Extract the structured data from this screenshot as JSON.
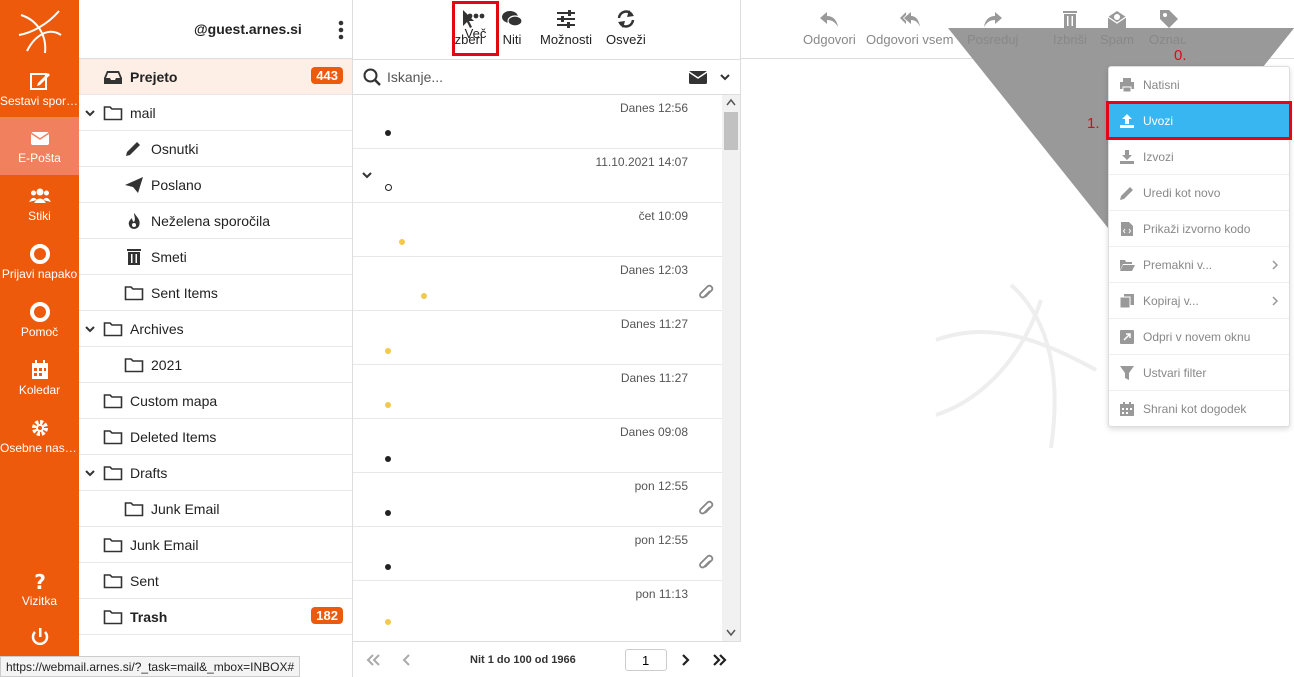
{
  "nav": {
    "items": [
      {
        "label": "Sestavi sporočilo",
        "icon": "compose-icon"
      },
      {
        "label": "E-Pošta",
        "icon": "mail-icon"
      },
      {
        "label": "Stiki",
        "icon": "contacts-icon"
      },
      {
        "label": "Prijavi napako",
        "icon": "lifebuoy-icon"
      },
      {
        "label": "Pomoč",
        "icon": "lifebuoy-icon"
      },
      {
        "label": "Koledar",
        "icon": "calendar-icon"
      },
      {
        "label": "Osebne nastavitve",
        "icon": "gear-icon"
      },
      {
        "label": "Vizitka",
        "icon": "question-icon"
      },
      {
        "label": "Odjava",
        "icon": "power-icon"
      }
    ]
  },
  "folders": {
    "account": "@guest.arnes.si",
    "items": [
      {
        "name": "Prejeto",
        "badge": "443"
      },
      {
        "name": "mail"
      },
      {
        "name": "Osnutki"
      },
      {
        "name": "Poslano"
      },
      {
        "name": "Neželena sporočila"
      },
      {
        "name": "Smeti"
      },
      {
        "name": "Sent Items"
      },
      {
        "name": "Archives"
      },
      {
        "name": "2021"
      },
      {
        "name": "Custom mapa"
      },
      {
        "name": "Deleted Items"
      },
      {
        "name": "Drafts"
      },
      {
        "name": "Junk Email"
      },
      {
        "name": "Junk Email"
      },
      {
        "name": "Sent"
      },
      {
        "name": "Trash",
        "badge": "182"
      }
    ]
  },
  "list_toolbar": {
    "select": "Izberi",
    "threads": "Niti",
    "options": "Možnosti",
    "refresh": "Osveži"
  },
  "search": {
    "placeholder": "Iskanje..."
  },
  "messages": [
    {
      "date": "Danes 12:56"
    },
    {
      "date": "11.10.2021 14:07"
    },
    {
      "date": "čet 10:09"
    },
    {
      "date": "Danes 12:03"
    },
    {
      "date": "Danes 11:27"
    },
    {
      "date": "Danes 11:27"
    },
    {
      "date": "Danes 09:08"
    },
    {
      "date": "pon 12:55"
    },
    {
      "date": "pon 12:55"
    },
    {
      "date": "pon 11:13"
    }
  ],
  "pager": {
    "info": "Nit 1 do 100 od 1966",
    "page": "1"
  },
  "preview_toolbar": {
    "reply": "Odgovori",
    "reply_all": "Odgovori vsem",
    "forward": "Posreduj",
    "delete": "Izbriši",
    "spam": "Spam",
    "mark": "Označi",
    "more": "Več"
  },
  "annotations": {
    "step0": "0.",
    "step1": "1."
  },
  "more_menu": [
    {
      "label": "Natisni"
    },
    {
      "label": "Uvozi"
    },
    {
      "label": "Izvozi"
    },
    {
      "label": "Uredi kot novo"
    },
    {
      "label": "Prikaži izvorno kodo"
    },
    {
      "label": "Premakni v..."
    },
    {
      "label": "Kopiraj v..."
    },
    {
      "label": "Odpri v novem oknu"
    },
    {
      "label": "Ustvari filter"
    },
    {
      "label": "Shrani kot dogodek"
    }
  ],
  "statusbar": {
    "url": "https://webmail.arnes.si/?_task=mail&_mbox=INBOX#"
  },
  "colors": {
    "brand": "#ed5a0c",
    "highlight": "#37b6f1",
    "annotation": "#e30613"
  }
}
